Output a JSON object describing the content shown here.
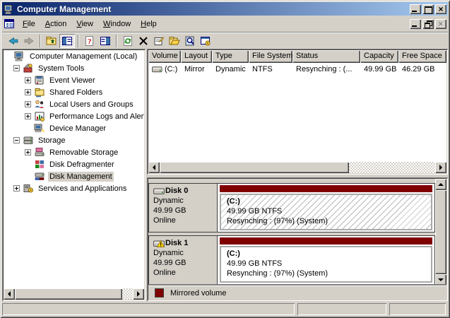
{
  "window": {
    "title": "Computer Management",
    "controls": [
      "minimize-icon",
      "maximize-icon",
      "close-icon"
    ],
    "child_controls": [
      "minimize-icon",
      "restore-icon",
      "close-icon-disabled"
    ],
    "close_glyph": "×"
  },
  "menu": {
    "items": [
      {
        "key": "F",
        "rest": "ile"
      },
      {
        "key": "A",
        "rest": "ction"
      },
      {
        "key": "V",
        "rest": "iew"
      },
      {
        "key": "W",
        "rest": "indow"
      },
      {
        "key": "H",
        "rest": "elp"
      }
    ]
  },
  "toolbar": {
    "buttons": [
      "back",
      "forward",
      "up-level",
      "show-hide-tree",
      "help-doc",
      "show-panel",
      "refresh",
      "delete",
      "properties",
      "open-folder",
      "view",
      "help"
    ]
  },
  "tree": {
    "items": [
      {
        "label": "Computer Management (Local)",
        "level": 0,
        "expander": "",
        "icon": "computer",
        "selected": false
      },
      {
        "label": "System Tools",
        "level": 1,
        "expander": "-",
        "icon": "system-tools",
        "selected": false
      },
      {
        "label": "Event Viewer",
        "level": 2,
        "expander": "+",
        "icon": "event-viewer",
        "selected": false
      },
      {
        "label": "Shared Folders",
        "level": 2,
        "expander": "+",
        "icon": "shared-folders",
        "selected": false
      },
      {
        "label": "Local Users and Groups",
        "level": 2,
        "expander": "+",
        "icon": "local-users",
        "selected": false
      },
      {
        "label": "Performance Logs and Alerts",
        "level": 2,
        "expander": "+",
        "icon": "performance",
        "selected": false
      },
      {
        "label": "Device Manager",
        "level": 2,
        "expander": "",
        "icon": "device-manager",
        "selected": false
      },
      {
        "label": "Storage",
        "level": 1,
        "expander": "-",
        "icon": "storage",
        "selected": false
      },
      {
        "label": "Removable Storage",
        "level": 2,
        "expander": "+",
        "icon": "removable-storage",
        "selected": false
      },
      {
        "label": "Disk Defragmenter",
        "level": 2,
        "expander": "",
        "icon": "disk-defragmenter",
        "selected": false
      },
      {
        "label": "Disk Management",
        "level": 2,
        "expander": "",
        "icon": "disk-management",
        "selected": true
      },
      {
        "label": "Services and Applications",
        "level": 1,
        "expander": "+",
        "icon": "services",
        "selected": false
      }
    ]
  },
  "volume_list": {
    "columns": [
      "Volume",
      "Layout",
      "Type",
      "File System",
      "Status",
      "Capacity",
      "Free Space"
    ],
    "rows": [
      {
        "volume": "(C:)",
        "layout": "Mirror",
        "type": "Dynamic",
        "file_system": "NTFS",
        "status": "Resynching : (...",
        "capacity": "49.99 GB",
        "free_space": "46.29 GB"
      }
    ]
  },
  "disks": [
    {
      "name": "Disk 0",
      "type": "Dynamic",
      "capacity": "49.99 GB",
      "status": "Online",
      "warning": false,
      "volume": {
        "label": "(C:)",
        "size_fs": "49.99 GB NTFS",
        "status": "Resynching : (97%) (System)",
        "selected_hatch": true
      }
    },
    {
      "name": "Disk 1",
      "type": "Dynamic",
      "capacity": "49.99 GB",
      "status": "Online",
      "warning": true,
      "volume": {
        "label": "(C:)",
        "size_fs": "49.99 GB NTFS",
        "status": "Resynching : (97%) (System)",
        "selected_hatch": false
      }
    }
  ],
  "legend": {
    "label": "Mirrored volume",
    "color": "#800000"
  },
  "colors": {
    "window_face": "#D4D0C8",
    "title_gradient_start": "#0A246A",
    "title_gradient_end": "#A6CAF0",
    "mirrored_volume": "#800000",
    "inactive_selection": "#D4D0C8",
    "panel_white": "#FFFFFF"
  }
}
